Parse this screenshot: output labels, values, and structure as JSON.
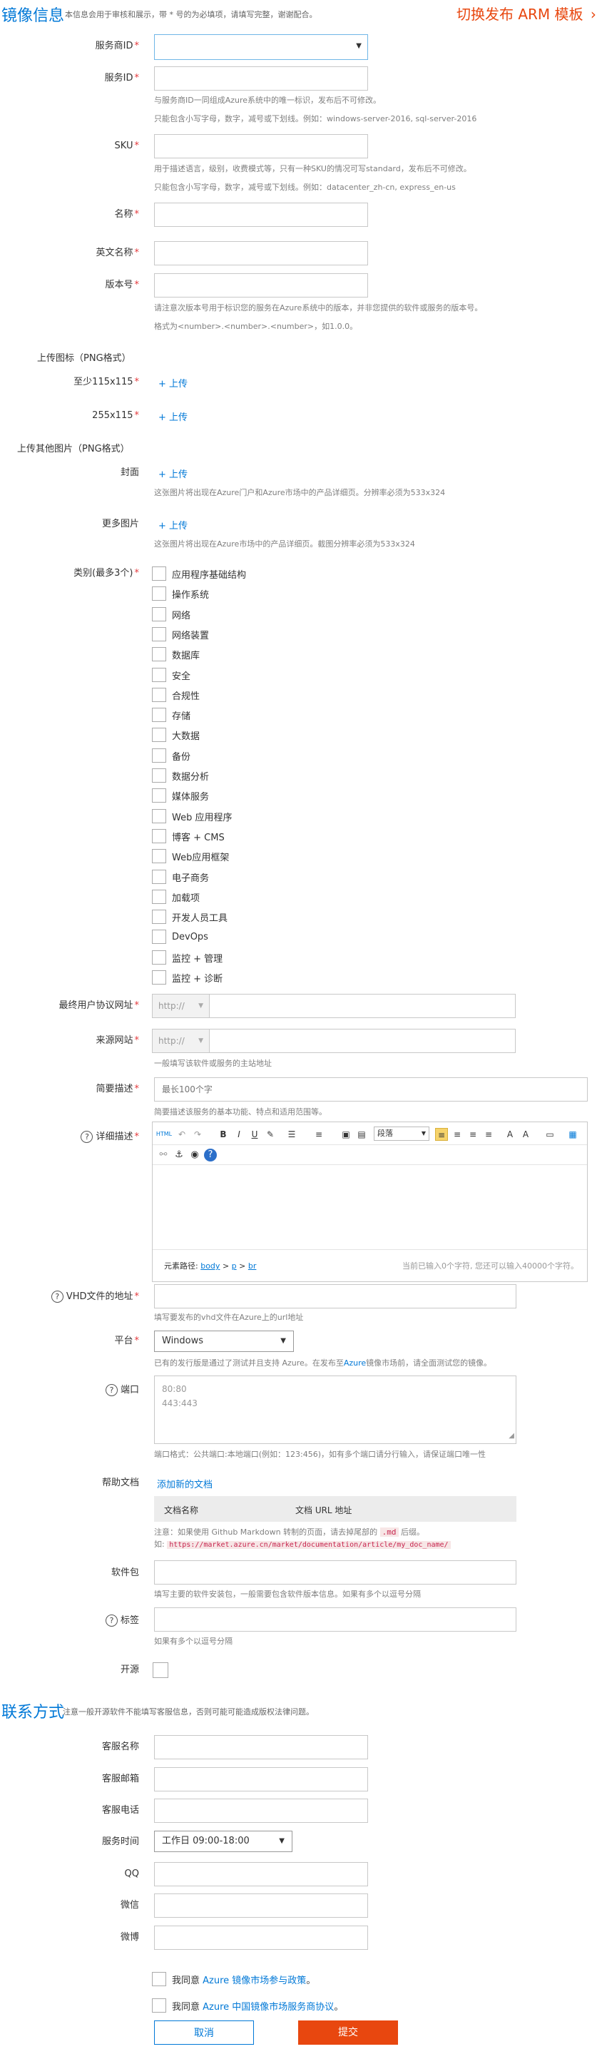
{
  "header": {
    "title": "镜像信息",
    "note": "本信息会用于审核和展示，带 * 号的为必填项，请填写完整，谢谢配合。",
    "switch_link": "切换发布 ARM 模板",
    "switch_arrow": "›"
  },
  "required_mark": "*",
  "fields": {
    "vendor_id": {
      "label": "服务商ID"
    },
    "service_id": {
      "label": "服务ID",
      "help1": "与服务商ID一同组成Azure系统中的唯一标识，发布后不可修改。",
      "help2": "只能包含小写字母，数字，减号或下划线。例如：windows-server-2016, sql-server-2016"
    },
    "sku": {
      "label": "SKU",
      "help1": "用于描述语言，级别，收费模式等，只有一种SKU的情况可写standard，发布后不可修改。",
      "help2": "只能包含小写字母，数字，减号或下划线。例如：datacenter_zh-cn, express_en-us"
    },
    "name": {
      "label": "名称"
    },
    "en_name": {
      "label": "英文名称"
    },
    "version": {
      "label": "版本号",
      "help1": "请注意次版本号用于标识您的服务在Azure系统中的版本，并非您提供的软件或服务的版本号。",
      "help2": "格式为<number>.<number>.<number>，如1.0.0。"
    }
  },
  "icons_section": {
    "title": "上传图标（PNG格式）",
    "size1": "至少115x115",
    "size2": "255x115",
    "upload": "+ 上传"
  },
  "other_images": {
    "title": "上传其他图片（PNG格式）",
    "cover_label": "封面",
    "cover_help": "这张图片将出现在Azure门户和Azure市场中的产品详细页。分辨率必须为533x324",
    "more_label": "更多图片",
    "more_help": "这张图片将出现在Azure市场中的产品详细页。截图分辨率必须为533x324",
    "upload": "+ 上传"
  },
  "categories": {
    "label": "类别(最多3个)",
    "items": [
      "应用程序基础结构",
      "操作系统",
      "网络",
      "网络装置",
      "数据库",
      "安全",
      "合规性",
      "存储",
      "大数据",
      "备份",
      "数据分析",
      "媒体服务",
      "Web 应用程序",
      "博客 + CMS",
      "Web应用框架",
      "电子商务",
      "加载项",
      "开发人员工具",
      "DevOps",
      "监控 + 管理",
      "监控 + 诊断"
    ]
  },
  "eula": {
    "label": "最终用户协议网址",
    "protocol": "http://"
  },
  "source_site": {
    "label": "来源网站",
    "protocol": "http://",
    "help": "一般填写该软件或服务的主站地址"
  },
  "brief": {
    "label": "简要描述",
    "placeholder": "最长100个字",
    "help": "简要描述该服务的基本功能、特点和适用范围等。"
  },
  "detail": {
    "label": "详细描述",
    "qmark": "?",
    "toolbar": {
      "html": "HTML",
      "font_size": "段落",
      "bold": "B",
      "italic": "I",
      "underline": "U"
    },
    "path_label": "元素路径:",
    "path_items": [
      "body",
      "p",
      "br"
    ],
    "path_sep": ">",
    "counter": "当前已输入0个字符, 您还可以输入40000个字符。"
  },
  "vhd": {
    "label": "VHD文件的地址",
    "qmark": "?",
    "help": "填写要发布的vhd文件在Azure上的url地址"
  },
  "platform": {
    "label": "平台",
    "value": "Windows",
    "help_prefix": "已有的发行版是通过了测试并且支持 Azure。在发布至",
    "help_link": "Azure",
    "help_suffix": "镜像市场前，请全面测试您的镜像。"
  },
  "ports": {
    "label": "端口",
    "qmark": "?",
    "lines": [
      "80:80",
      "443:443"
    ],
    "help": "端口格式：公共端口:本地端口(例如：123:456)，如有多个端口请分行输入，请保证端口唯一性"
  },
  "docs": {
    "label": "帮助文档",
    "add_link": "添加新的文档",
    "col_name": "文档名称",
    "col_url": "文档 URL 地址",
    "note1_prefix": "注意：如果使用 Github Markdown 转制的页面，请去掉尾部的",
    "note1_code": ".md",
    "note1_suffix": "后缀。",
    "note2_prefix": "如:",
    "note2_code": "https://market.azure.cn/market/documentation/article/my_doc_name/"
  },
  "packages": {
    "label": "软件包",
    "help": "填写主要的软件安装包，一般需要包含软件版本信息。如果有多个以逗号分隔"
  },
  "tags": {
    "label": "标签",
    "qmark": "?",
    "help": "如果有多个以逗号分隔"
  },
  "opensource": {
    "label": "开源"
  },
  "contact": {
    "title": "联系方式",
    "note": "注意一般开源软件不能填写客服信息，否则可能可能造成版权法律问题。",
    "name": "客服名称",
    "email": "客服邮箱",
    "phone": "客服电话",
    "hours_label": "服务时间",
    "hours_value": "工作日 09:00-18:00",
    "qq": "QQ",
    "wechat": "微信",
    "weibo": "微博"
  },
  "agreements": {
    "a1_prefix": "我同意",
    "a1_link": "Azure 镜像市场参与政策",
    "a1_suffix": "。",
    "a2_prefix": "我同意",
    "a2_link": "Azure 中国镜像市场服务商协议",
    "a2_suffix": "。"
  },
  "actions": {
    "cancel": "取消",
    "submit": "提交"
  },
  "colors": {
    "accent": "#0078d7",
    "orange": "#e8470f",
    "required": "#e4393c"
  }
}
